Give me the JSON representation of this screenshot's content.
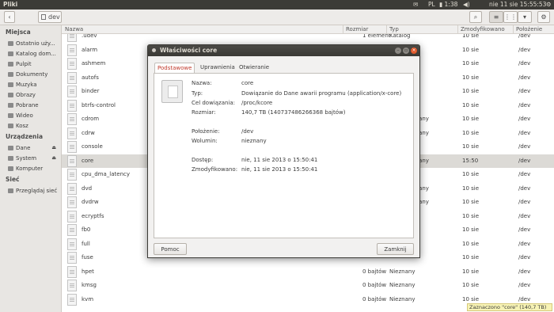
{
  "topbar": {
    "title": "Pliki",
    "lang": "PL",
    "battery": "1:38",
    "datetime": "nie 11 sie 15:55:53"
  },
  "toolbar": {
    "path_segment": "dev",
    "back_icon": "chevron-left-icon",
    "search_icon": "search-icon",
    "list_view_icon": "list-view-icon",
    "grid_view_icon": "grid-view-icon",
    "compact_view_icon": "compact-view-icon",
    "settings_icon": "gear-icon"
  },
  "sidebar": {
    "places_title": "Miejsca",
    "places": [
      "Ostatnio uży...",
      "Katalog dom...",
      "Pulpit",
      "Dokumenty",
      "Muzyka",
      "Obrazy",
      "Pobrane",
      "Wideo",
      "Kosz"
    ],
    "devices_title": "Urządzenia",
    "devices": [
      "Dane",
      "System",
      "Komputer"
    ],
    "network_title": "Sieć",
    "network": [
      "Przeglądaj sieć"
    ]
  },
  "columns": {
    "name": "Nazwa",
    "size": "Rozmiar",
    "type": "Typ",
    "modified": "Zmodyfikowano",
    "location": "Położenie"
  },
  "files": [
    {
      "name": ".udev",
      "size": "1 element",
      "type": "Katalog",
      "modified": "10 sie",
      "location": "/dev"
    },
    {
      "name": "alarm",
      "size": "",
      "type": "",
      "modified": "10 sie",
      "location": "/dev"
    },
    {
      "name": "ashmem",
      "size": "",
      "type": "",
      "modified": "10 sie",
      "location": "/dev"
    },
    {
      "name": "autofs",
      "size": "",
      "type": "",
      "modified": "10 sie",
      "location": "/dev"
    },
    {
      "name": "binder",
      "size": "",
      "type": "",
      "modified": "10 sie",
      "location": "/dev"
    },
    {
      "name": "btrfs-control",
      "size": "",
      "type": "",
      "modified": "10 sie",
      "location": "/dev"
    },
    {
      "name": "cdrom",
      "size": "",
      "type": "e do Nieznany",
      "modified": "10 sie",
      "location": "/dev"
    },
    {
      "name": "cdrw",
      "size": "",
      "type": "e do Nieznany",
      "modified": "10 sie",
      "location": "/dev"
    },
    {
      "name": "console",
      "size": "",
      "type": "",
      "modified": "10 sie",
      "location": "/dev"
    },
    {
      "name": "core",
      "size": "",
      "type": "e do Nieznany",
      "modified": "15:50",
      "location": "/dev"
    },
    {
      "name": "cpu_dma_latency",
      "size": "",
      "type": "",
      "modified": "10 sie",
      "location": "/dev"
    },
    {
      "name": "dvd",
      "size": "",
      "type": "e do Nieznany",
      "modified": "10 sie",
      "location": "/dev"
    },
    {
      "name": "dvdrw",
      "size": "",
      "type": "e do Nieznany",
      "modified": "10 sie",
      "location": "/dev"
    },
    {
      "name": "ecryptfs",
      "size": "",
      "type": "",
      "modified": "10 sie",
      "location": "/dev"
    },
    {
      "name": "fb0",
      "size": "",
      "type": "",
      "modified": "10 sie",
      "location": "/dev"
    },
    {
      "name": "full",
      "size": "",
      "type": "",
      "modified": "10 sie",
      "location": "/dev"
    },
    {
      "name": "fuse",
      "size": "",
      "type": "",
      "modified": "10 sie",
      "location": "/dev"
    },
    {
      "name": "hpet",
      "size": "0 bajtów",
      "type": "Nieznany",
      "modified": "10 sie",
      "location": "/dev"
    },
    {
      "name": "kmsg",
      "size": "0 bajtów",
      "type": "Nieznany",
      "modified": "10 sie",
      "location": "/dev"
    },
    {
      "name": "kvm",
      "size": "0 bajtów",
      "type": "Nieznany",
      "modified": "10 sie",
      "location": "/dev"
    }
  ],
  "selected_index": 9,
  "status": "Zaznaczono \"core\" (140,7 TB)",
  "dialog": {
    "title": "Właściwości core",
    "tabs": [
      "Podstawowe",
      "Uprawnienia",
      "Otwieranie"
    ],
    "fields": [
      {
        "label": "Nazwa:",
        "value": "core"
      },
      {
        "label": "Typ:",
        "value": "Dowiązanie do Dane awarii programu (application/x-core)"
      },
      {
        "label": "Cel dowiązania:",
        "value": "/proc/kcore"
      },
      {
        "label": "Rozmiar:",
        "value": "140,7 TB (140737486266368 bajtów)"
      },
      {
        "label": "Położenie:",
        "value": "/dev"
      },
      {
        "label": "Wolumin:",
        "value": "nieznany"
      },
      {
        "label": "Dostęp:",
        "value": "nie, 11 sie 2013 o 15:50:41"
      },
      {
        "label": "Zmodyfikowano:",
        "value": "nie, 11 sie 2013 o 15:50:41"
      }
    ],
    "help_button": "Pomoc",
    "close_button": "Zamknij"
  }
}
